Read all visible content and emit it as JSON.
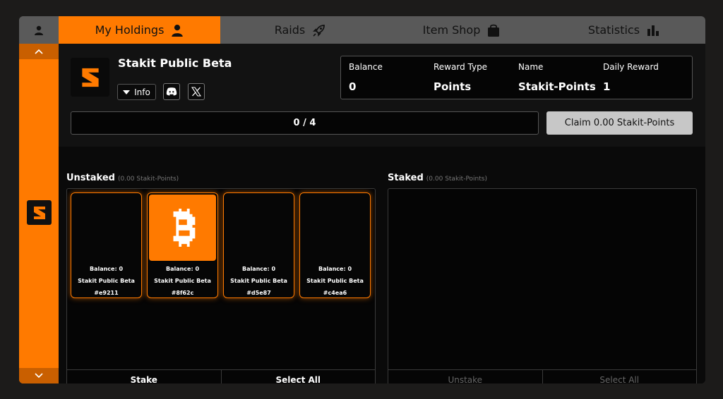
{
  "nav": {
    "tabs": [
      {
        "label": "My Holdings",
        "icon": "user-icon",
        "active": true
      },
      {
        "label": "Raids",
        "icon": "rocket-icon",
        "active": false
      },
      {
        "label": "Item Shop",
        "icon": "shopping-bag-icon",
        "active": false
      },
      {
        "label": "Statistics",
        "icon": "bar-chart-icon",
        "active": false
      }
    ]
  },
  "project": {
    "name": "Stakit Public Beta",
    "info_label": "Info",
    "social": [
      "discord-icon",
      "x-icon"
    ]
  },
  "stats": [
    {
      "label": "Balance",
      "value": "0"
    },
    {
      "label": "Reward Type",
      "value": "Points"
    },
    {
      "label": "Name",
      "value": "Stakit-Points"
    },
    {
      "label": "Daily Reward",
      "value": "1"
    }
  ],
  "progress": {
    "text": "0 / 4"
  },
  "claim_label": "Claim 0.00 Stakit-Points",
  "unstaked": {
    "title": "Unstaked",
    "subtitle": "(0.00 Stakit-Points)",
    "cards": [
      {
        "balance": "Balance: 0",
        "name": "Stakit Public Beta",
        "id": "#e9211",
        "has_image": false
      },
      {
        "balance": "Balance: 0",
        "name": "Stakit Public Beta",
        "id": "#8f62c",
        "has_image": true
      },
      {
        "balance": "Balance: 0",
        "name": "Stakit Public Beta",
        "id": "#d5e87",
        "has_image": false
      },
      {
        "balance": "Balance: 0",
        "name": "Stakit Public Beta",
        "id": "#c4ea6",
        "has_image": false
      }
    ],
    "stake_label": "Stake",
    "select_all_label": "Select All"
  },
  "staked": {
    "title": "Staked",
    "subtitle": "(0.00 Stakit-Points)",
    "unstake_label": "Unstake",
    "select_all_label": "Select All"
  },
  "colors": {
    "accent": "#ff7a00",
    "nav_bg": "#595959",
    "claim_bg": "#c7c7c7"
  }
}
